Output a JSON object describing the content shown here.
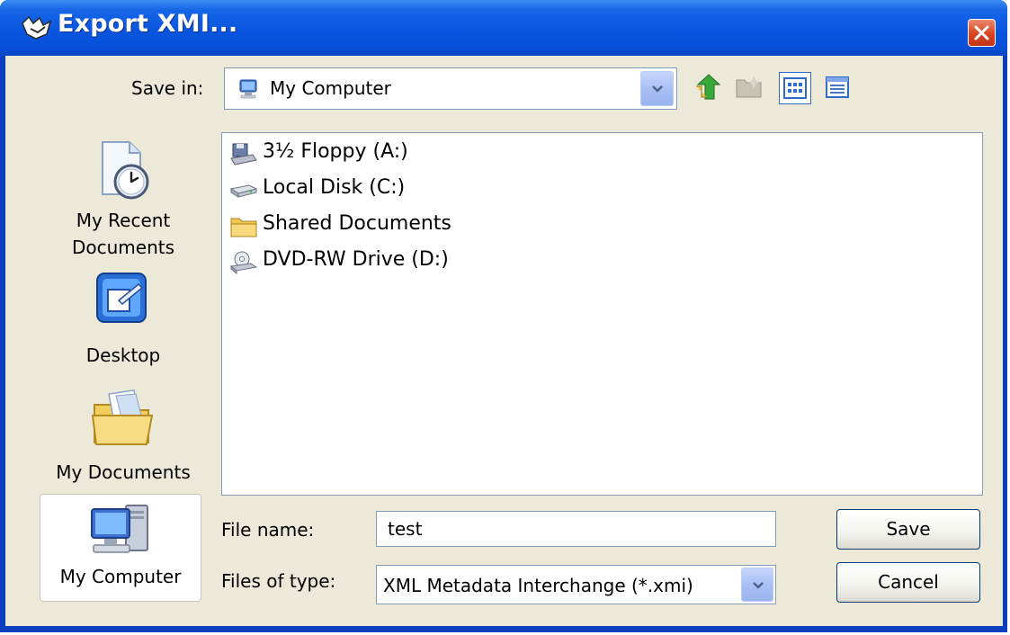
{
  "window": {
    "title": "Export XMI..."
  },
  "save_in": {
    "label": "Save in:",
    "value": "My Computer"
  },
  "places": [
    {
      "label_lines": [
        "My Recent",
        "Documents"
      ],
      "icon": "recent-documents-icon"
    },
    {
      "label_lines": [
        "Desktop"
      ],
      "icon": "desktop-icon"
    },
    {
      "label_lines": [
        "My Documents"
      ],
      "icon": "my-documents-icon"
    },
    {
      "label_lines": [
        "My Computer"
      ],
      "icon": "my-computer-icon",
      "selected": true
    }
  ],
  "files": [
    {
      "name": "3½ Floppy (A:)",
      "icon": "floppy-drive-icon"
    },
    {
      "name": "Local Disk (C:)",
      "icon": "hard-disk-icon"
    },
    {
      "name": "Shared Documents",
      "icon": "folder-icon"
    },
    {
      "name": "DVD-RW Drive (D:)",
      "icon": "dvd-drive-icon"
    }
  ],
  "file_name": {
    "label": "File name:",
    "value": "test"
  },
  "file_type": {
    "label": "Files of type:",
    "value": "XML Metadata Interchange (*.xmi)"
  },
  "buttons": {
    "save": "Save",
    "cancel": "Cancel"
  },
  "colors": {
    "titlebar": "#0a55e0",
    "client": "#ece9d8",
    "close": "#d9431e",
    "border": "#7f9db9"
  }
}
